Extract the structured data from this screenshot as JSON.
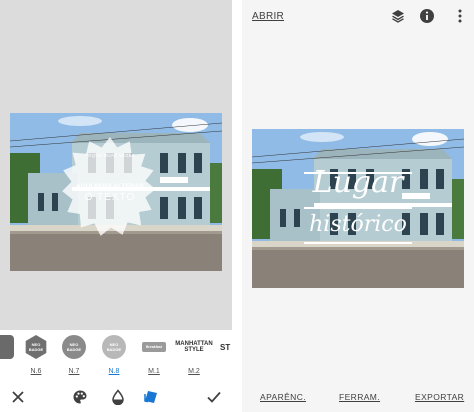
{
  "left_panel": {
    "overlay_text": {
      "small_line": "TOQUE DUAS VEZES",
      "middle_line": "AQUI PARA ALTERAR",
      "big_line": "O TEXTO"
    },
    "styles": [
      {
        "label": "",
        "thumb": "",
        "color": "#6a6a6a"
      },
      {
        "label": "N.6",
        "thumb": "NEO BADGE",
        "color": "#707070"
      },
      {
        "label": "N.7",
        "thumb": "NEO BADGE",
        "color": "#8a8a8a"
      },
      {
        "label": "N.8",
        "thumb": "NEO BADGE",
        "color": "#b8b8b8",
        "active": true
      },
      {
        "label": "M.1",
        "thumb": "Breakfast",
        "color": "#9a9a9a"
      },
      {
        "label": "M.2",
        "thumb": "MANHATTAN STYLE",
        "color": "#505050"
      },
      {
        "label": "",
        "thumb": "ST",
        "color": "#505050"
      }
    ],
    "bottom_icons": [
      "close-icon",
      "palette-icon",
      "opacity-drop-icon",
      "style-tag-icon",
      "check-icon"
    ]
  },
  "right_panel": {
    "top_bar": {
      "open_label": "ABRIR",
      "icons": [
        "layers-icon",
        "info-icon",
        "more-vert-icon"
      ]
    },
    "title_line1": "Lugar",
    "title_line2": "histórico",
    "bottom_bar": {
      "looks": "APARÊNC.",
      "tools": "FERRAM.",
      "export": "EXPORTAR"
    }
  },
  "colors": {
    "accent": "#1976d2",
    "text": "#404040",
    "background": "#f5f5f5"
  }
}
